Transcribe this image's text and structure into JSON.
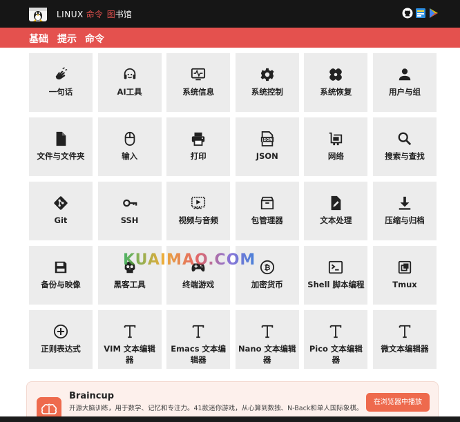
{
  "header": {
    "brand_linux": "LINUX",
    "brand_cmd": "命令",
    "brand_tu": "图",
    "brand_lib": "书馆",
    "icons": [
      "github-icon",
      "translate-icon",
      "play-store-icon"
    ]
  },
  "tabs": [
    {
      "label": "基础",
      "active": true
    },
    {
      "label": "提示",
      "active": false
    },
    {
      "label": "命令",
      "active": false
    }
  ],
  "tiles": [
    {
      "label": "一句话",
      "icon": "wave-hand-icon"
    },
    {
      "label": "AI工具",
      "icon": "headset-icon"
    },
    {
      "label": "系统信息",
      "icon": "monitor-pulse-icon"
    },
    {
      "label": "系统控制",
      "icon": "gear-icon"
    },
    {
      "label": "系统恢复",
      "icon": "bandage-icon"
    },
    {
      "label": "用户与组",
      "icon": "person-icon"
    },
    {
      "label": "文件与文件夹",
      "icon": "file-icon"
    },
    {
      "label": "输入",
      "icon": "mouse-icon"
    },
    {
      "label": "打印",
      "icon": "printer-icon"
    },
    {
      "label": "JSON",
      "icon": "json-icon"
    },
    {
      "label": "网络",
      "icon": "network-card-icon"
    },
    {
      "label": "搜索与查找",
      "icon": "search-icon"
    },
    {
      "label": "Git",
      "icon": "git-icon"
    },
    {
      "label": "SSH",
      "icon": "key-icon"
    },
    {
      "label": "视频与音频",
      "icon": "video-icon"
    },
    {
      "label": "包管理器",
      "icon": "package-icon"
    },
    {
      "label": "文本处理",
      "icon": "edit-file-icon"
    },
    {
      "label": "压缩与归档",
      "icon": "download-icon"
    },
    {
      "label": "备份与映像",
      "icon": "floppy-icon"
    },
    {
      "label": "黑客工具",
      "icon": "skull-icon"
    },
    {
      "label": "终端游戏",
      "icon": "gamepad-icon"
    },
    {
      "label": "加密货币",
      "icon": "bitcoin-icon"
    },
    {
      "label": "Shell 脚本编程",
      "icon": "terminal-icon"
    },
    {
      "label": "Tmux",
      "icon": "tmux-icon"
    },
    {
      "label": "正则表达式",
      "icon": "plus-circle-icon"
    },
    {
      "label": "VIM 文本编辑器",
      "icon": "text-t-icon"
    },
    {
      "label": "Emacs 文本编辑器",
      "icon": "text-t-icon"
    },
    {
      "label": "Nano 文本编辑器",
      "icon": "text-t-icon"
    },
    {
      "label": "Pico 文本编辑器",
      "icon": "text-t-icon"
    },
    {
      "label": "微文本编辑器",
      "icon": "text-t-icon"
    }
  ],
  "watermark": "KUAIMAO.COM",
  "promo": {
    "title": "Braincup",
    "desc": "开源大脑训练，用于数学、记忆和专注力。41款迷你游戏，从心算到数独、N-Back和单人国际象棋。",
    "button": "在浏览器中播放",
    "icon": "brain-icon"
  },
  "colors": {
    "accent": "#e4514e",
    "topbar": "#161616",
    "tile": "#ececec",
    "promo": "#ee6a4d"
  }
}
